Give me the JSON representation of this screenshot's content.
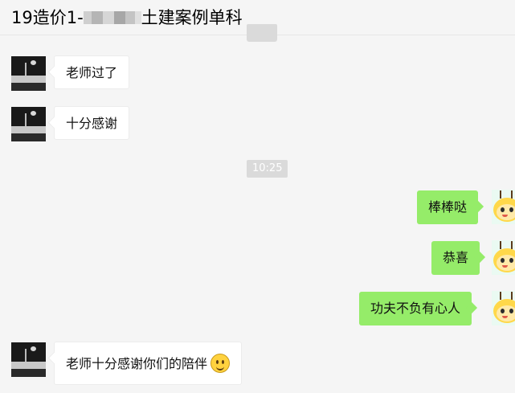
{
  "header": {
    "title_prefix": "19造价1-",
    "title_suffix": "土建案例单科"
  },
  "timestamps": {
    "top": "",
    "middle": "10:25"
  },
  "messages": [
    {
      "side": "left",
      "text": "老师过了"
    },
    {
      "side": "left",
      "text": "十分感谢"
    },
    {
      "side": "right",
      "text": "棒棒哒"
    },
    {
      "side": "right",
      "text": "恭喜"
    },
    {
      "side": "right",
      "text": "功夫不负有心人"
    },
    {
      "side": "left",
      "text": "老师十分感谢你们的陪伴",
      "emoji": "smile-emoji"
    }
  ],
  "colors": {
    "background": "#f5f5f5",
    "incoming_bubble": "#ffffff",
    "outgoing_bubble": "#95ec69",
    "timestamp_bg": "#dadada"
  }
}
